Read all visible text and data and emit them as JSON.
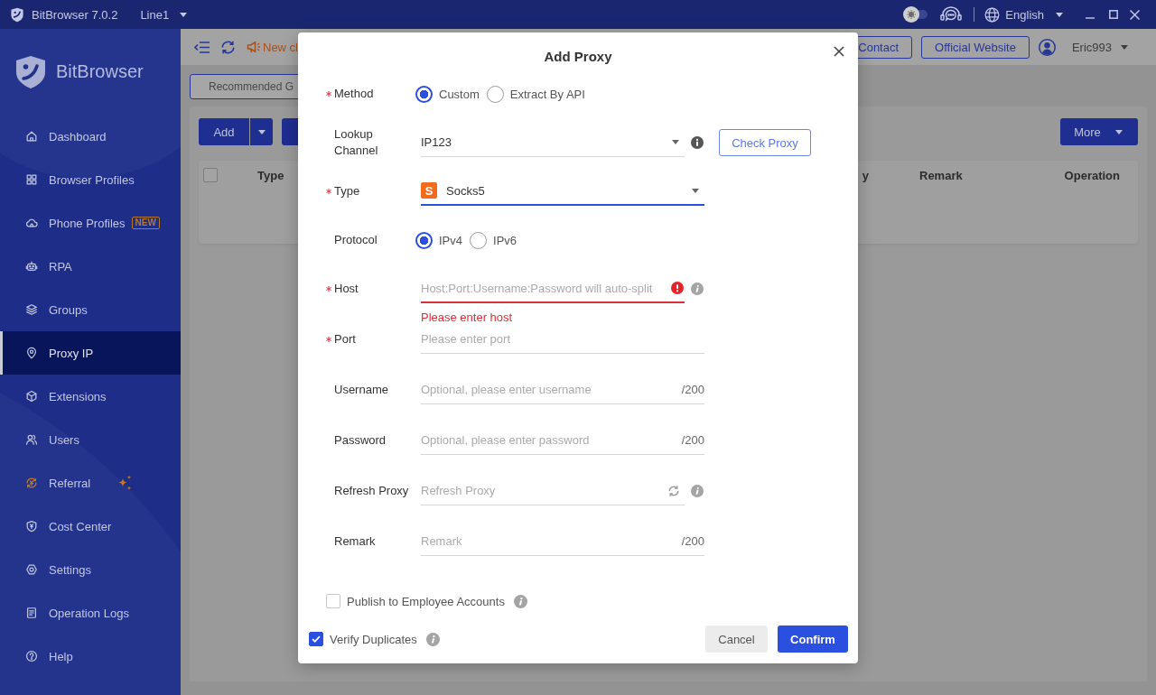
{
  "title_bar": {
    "app_name": "BitBrowser 7.0.2",
    "line": "Line1",
    "theme_toggle": {
      "on": false
    },
    "language": "English"
  },
  "sidebar": {
    "brand": "BitBrowser",
    "items": [
      {
        "label": "Dashboard",
        "selected": false,
        "kind": "link"
      },
      {
        "label": "Browser Profiles",
        "selected": false,
        "kind": "link"
      },
      {
        "label": "Phone Profiles",
        "selected": false,
        "kind": "link",
        "badge": "NEW"
      },
      {
        "label": "RPA",
        "selected": false,
        "kind": "link"
      },
      {
        "label": "Groups",
        "selected": false,
        "kind": "link"
      },
      {
        "label": "Proxy IP",
        "selected": true,
        "kind": "link"
      },
      {
        "label": "Extensions",
        "selected": false,
        "kind": "link"
      },
      {
        "label": "Users",
        "selected": false,
        "kind": "link"
      },
      {
        "label": "Referral",
        "selected": false,
        "kind": "promo"
      },
      {
        "label": "Cost Center",
        "selected": false,
        "kind": "link"
      },
      {
        "label": "Settings",
        "selected": false,
        "kind": "link"
      },
      {
        "label": "Operation Logs",
        "selected": false,
        "kind": "link"
      },
      {
        "label": "Help",
        "selected": false,
        "kind": "link"
      }
    ]
  },
  "header": {
    "notice": "New cl",
    "buttons": [
      "Contact",
      "Official Website"
    ],
    "user": "Eric993"
  },
  "filter_button": "Recommended G",
  "toolbar": {
    "add": "Add",
    "more": "More"
  },
  "table": {
    "select_all": {
      "checked": false
    },
    "columns": [
      "Type",
      "y",
      "Remark",
      "Operation"
    ]
  },
  "modal": {
    "title": "Add Proxy",
    "fields": [
      {
        "kind": "radio",
        "label": "Method",
        "required": true,
        "info": false,
        "options": [
          {
            "label": "Custom",
            "selected": true
          },
          {
            "label": "Extract By API",
            "selected": false
          }
        ]
      },
      {
        "kind": "select",
        "label": "Lookup Channel",
        "required": false,
        "info": true,
        "focused": false,
        "value": "IP123",
        "action": "Check Proxy"
      },
      {
        "kind": "select",
        "label": "Type",
        "required": true,
        "info": false,
        "focused": true,
        "logo": "S",
        "value": "Socks5"
      },
      {
        "kind": "radio",
        "label": "Protocol",
        "required": false,
        "info": false,
        "options": [
          {
            "label": "IPv4",
            "selected": true
          },
          {
            "label": "IPv6",
            "selected": false
          }
        ]
      },
      {
        "kind": "input",
        "label": "Host",
        "required": true,
        "info": true,
        "focused": false,
        "refresh": false,
        "placeholder": "Host:Port:Username:Password will auto-split",
        "error": "Please enter host"
      },
      {
        "kind": "input",
        "label": "Port",
        "required": true,
        "info": false,
        "focused": false,
        "refresh": false,
        "placeholder": "Please enter port"
      },
      {
        "kind": "input",
        "label": "Username",
        "required": false,
        "info": false,
        "focused": false,
        "refresh": false,
        "placeholder": "Optional, please enter username",
        "counter": "/200"
      },
      {
        "kind": "input",
        "label": "Password",
        "required": false,
        "info": false,
        "focused": false,
        "refresh": false,
        "placeholder": "Optional, please enter password",
        "counter": "/200"
      },
      {
        "kind": "input",
        "label": "Refresh Proxy",
        "required": false,
        "info": true,
        "focused": false,
        "refresh": true,
        "placeholder": "Refresh Proxy"
      },
      {
        "kind": "input",
        "label": "Remark",
        "required": false,
        "info": false,
        "focused": false,
        "refresh": false,
        "placeholder": "Remark",
        "counter": "/200"
      }
    ],
    "publish": {
      "label": "Publish to Employee Accounts",
      "checked": false
    },
    "verify": {
      "label": "Verify Duplicates",
      "checked": true
    },
    "buttons": [
      {
        "label": "Cancel",
        "kind": "secondary"
      },
      {
        "label": "Confirm",
        "kind": "primary"
      }
    ]
  }
}
